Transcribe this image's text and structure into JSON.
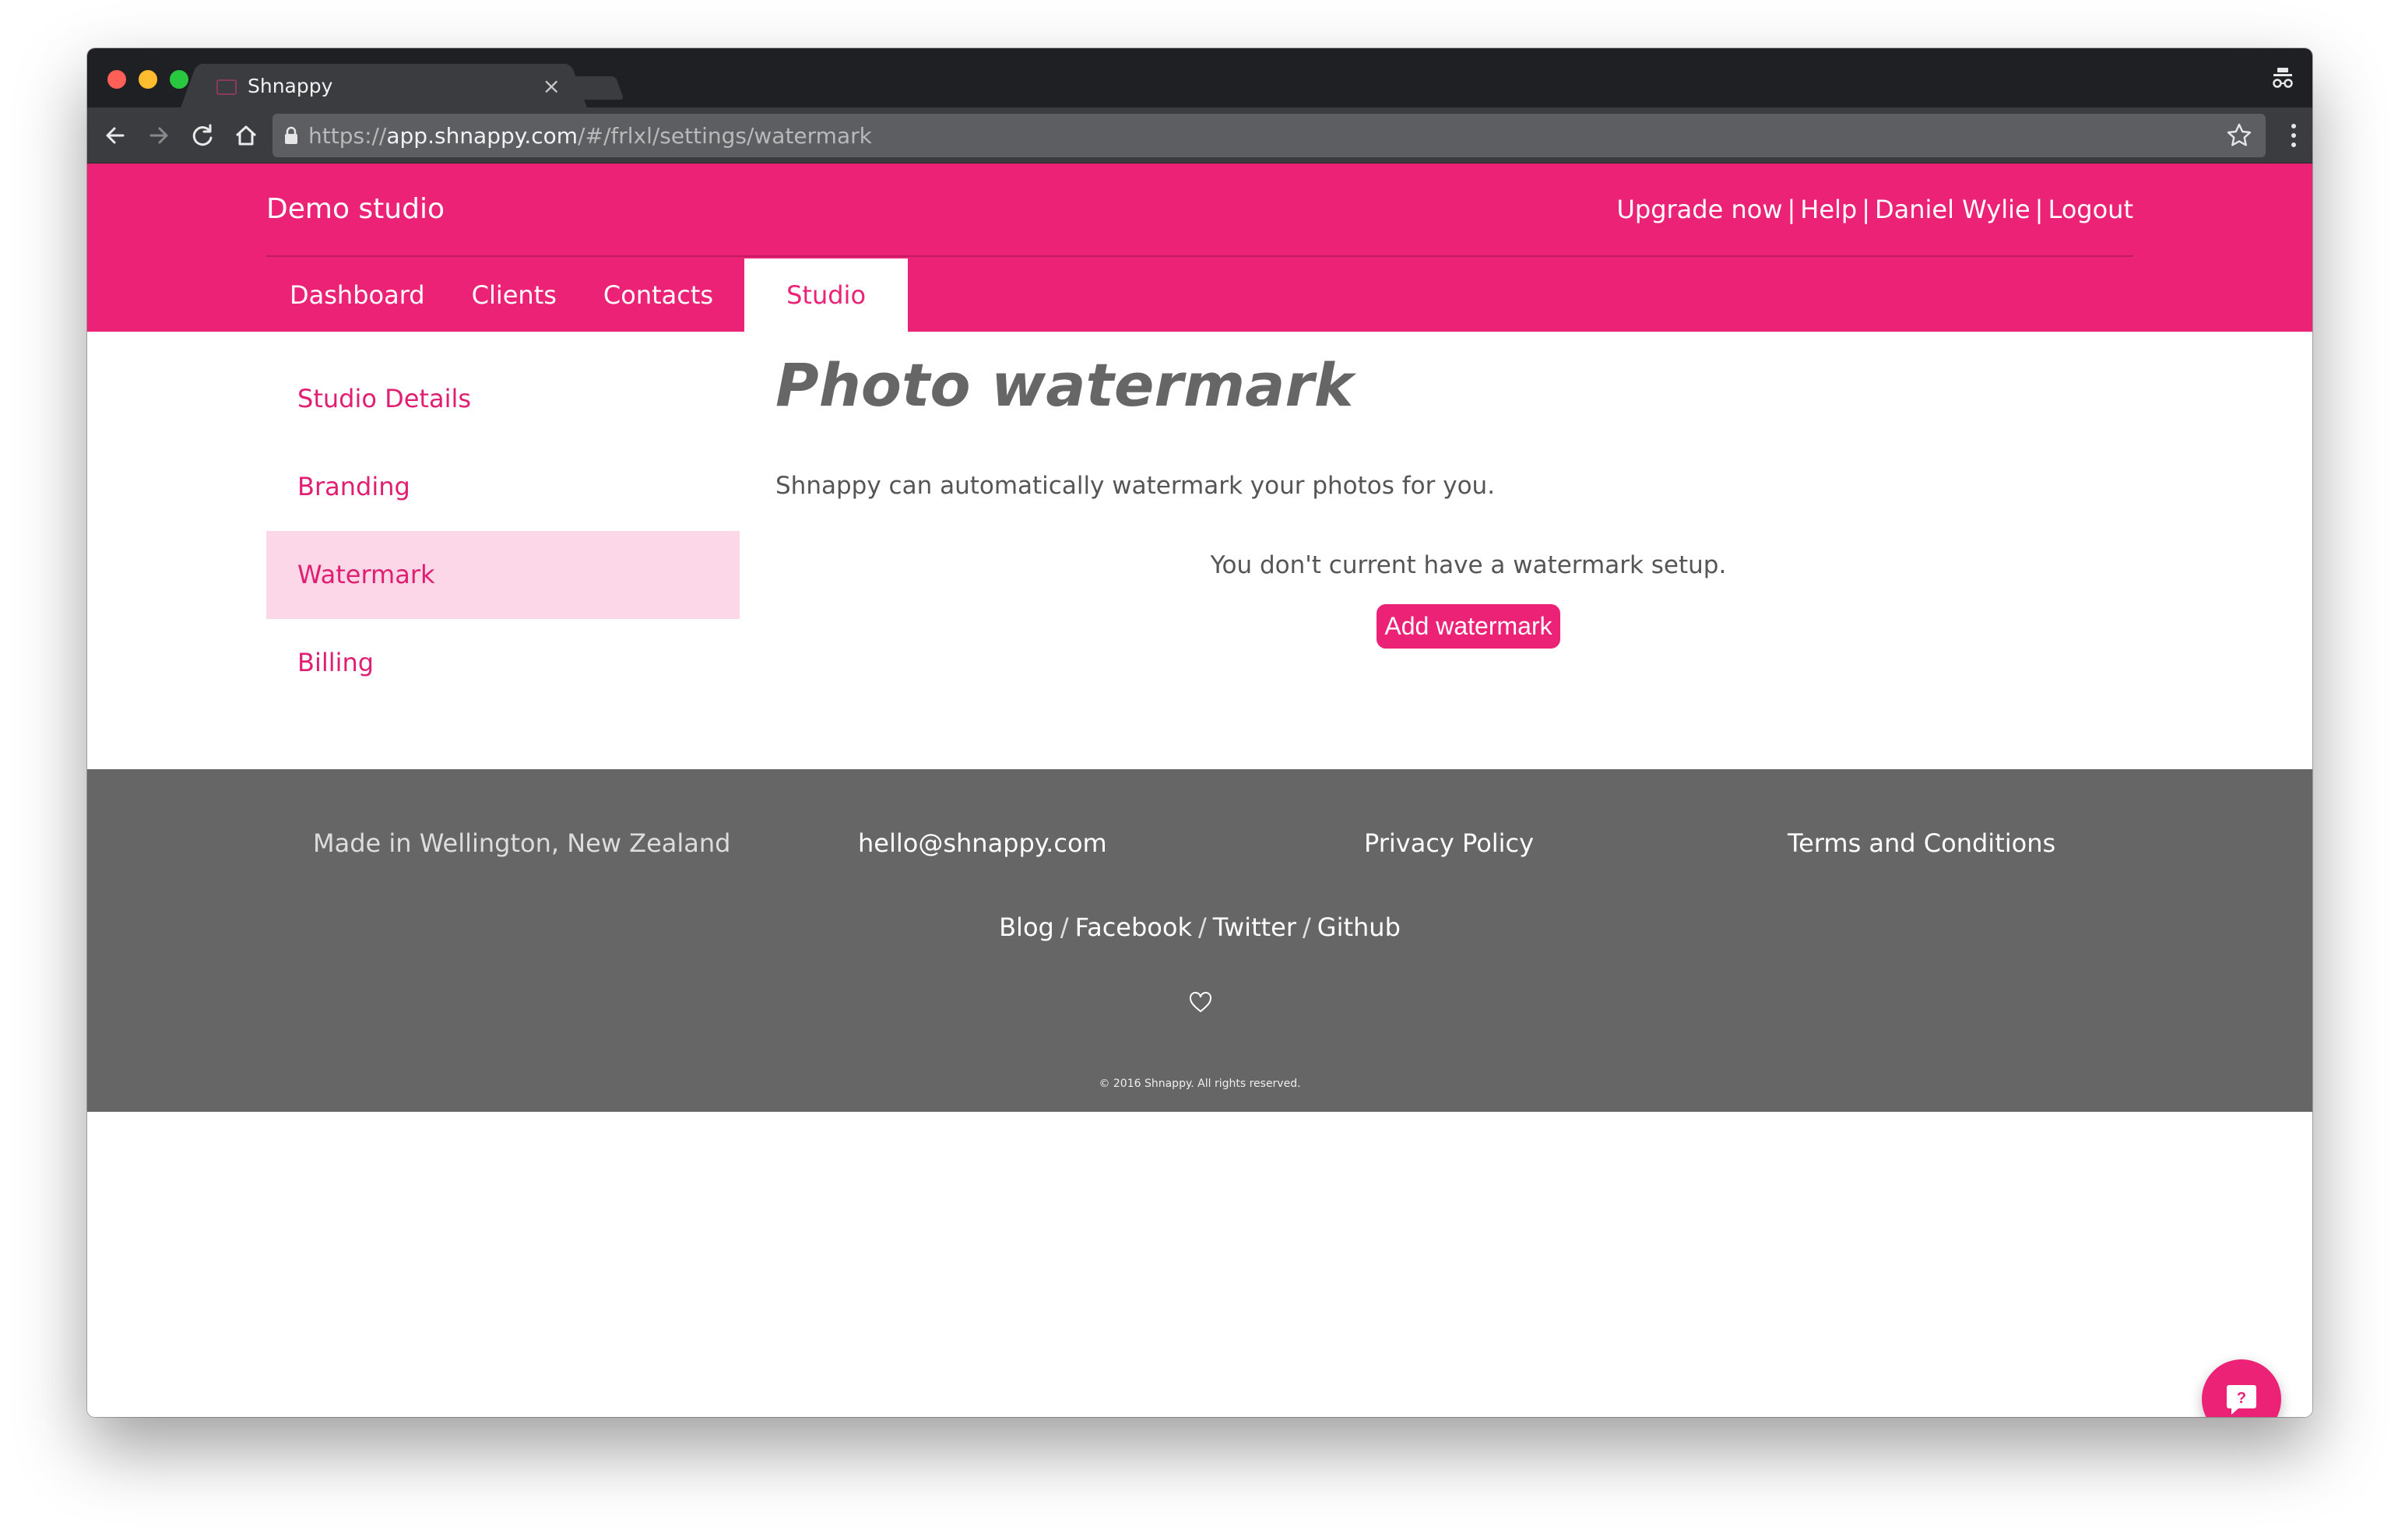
{
  "browser": {
    "tab_title": "Shnappy",
    "tab_close": "×",
    "url_scheme": "https://",
    "url_host": "app.shnappy.com",
    "url_path": "/#/frlxl/settings/watermark"
  },
  "header": {
    "studio_name": "Demo studio",
    "links": [
      "Upgrade now",
      "Help",
      "Daniel Wylie",
      "Logout"
    ],
    "link_separator": "|"
  },
  "main_nav": {
    "tabs": [
      {
        "label": "Dashboard"
      },
      {
        "label": "Clients"
      },
      {
        "label": "Contacts"
      },
      {
        "label": "Studio"
      }
    ],
    "active": "Studio"
  },
  "sidebar": {
    "items": [
      {
        "label": "Studio Details"
      },
      {
        "label": "Branding"
      },
      {
        "label": "Watermark"
      },
      {
        "label": "Billing"
      }
    ],
    "active": "Watermark"
  },
  "content": {
    "title": "Photo watermark",
    "intro": "Shnappy can automatically watermark your photos for you.",
    "notice": "You don't current have a watermark setup.",
    "add_button": "Add watermark"
  },
  "footer": {
    "made_in": "Made in Wellington, New Zealand",
    "email": "hello@shnappy.com",
    "privacy": "Privacy Policy",
    "terms": "Terms and Conditions",
    "social": [
      "Blog",
      "Facebook",
      "Twitter",
      "Github"
    ],
    "social_separator": "/",
    "copyright": "© 2016 Shnappy. All rights reserved."
  },
  "colors": {
    "brand": "#ec2277",
    "sidebar_active_bg": "#fbd7e7",
    "footer_bg": "#666666"
  },
  "icons": [
    "back-arrow-icon",
    "forward-arrow-icon",
    "reload-icon",
    "home-icon",
    "lock-icon",
    "star-icon",
    "menu-dots-icon",
    "incognito-icon",
    "heart-icon",
    "help-chat-icon"
  ]
}
